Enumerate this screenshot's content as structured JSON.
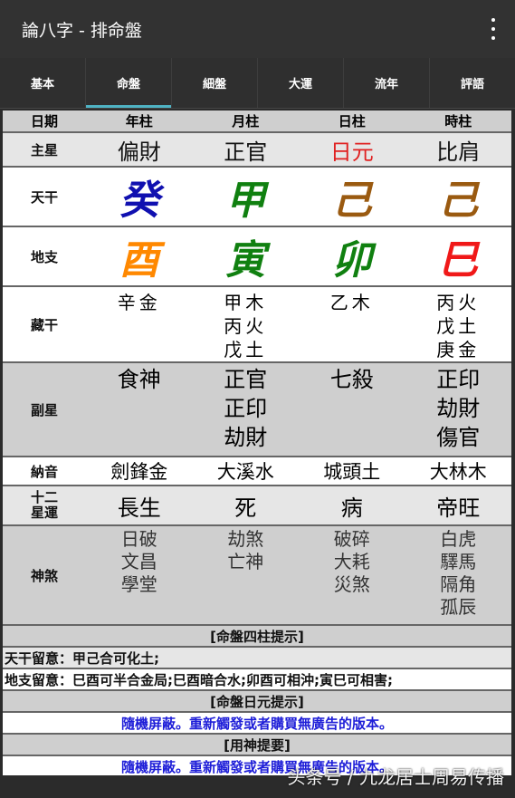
{
  "app": {
    "title": "論八字 - 排命盤"
  },
  "tabs": [
    {
      "label": "基本",
      "active": false
    },
    {
      "label": "命盤",
      "active": true
    },
    {
      "label": "細盤",
      "active": false
    },
    {
      "label": "大運",
      "active": false
    },
    {
      "label": "流年",
      "active": false
    },
    {
      "label": "評語",
      "active": false
    }
  ],
  "table": {
    "header": [
      "日期",
      "年柱",
      "月柱",
      "日柱",
      "時柱"
    ],
    "zhuxing": {
      "label": "主星",
      "values": [
        "偏財",
        "正官",
        "日元",
        "比肩"
      ],
      "colors": [
        "#111111",
        "#111111",
        "#e02020",
        "#111111"
      ]
    },
    "tiangan": {
      "label": "天干",
      "values": [
        "癸",
        "甲",
        "己",
        "己"
      ],
      "colors": [
        "#1010b0",
        "#108010",
        "#9a5a10",
        "#9a5a10"
      ]
    },
    "dizhi": {
      "label": "地支",
      "values": [
        "酉",
        "寅",
        "卯",
        "巳"
      ],
      "colors": [
        "#ff8800",
        "#108010",
        "#108010",
        "#f01818"
      ]
    },
    "canggan": {
      "label": "藏干",
      "values": [
        [
          "辛金"
        ],
        [
          "甲木",
          "丙火",
          "戊土"
        ],
        [
          "乙木"
        ],
        [
          "丙火",
          "戊土",
          "庚金"
        ]
      ]
    },
    "fuxing": {
      "label": "副星",
      "values": [
        [
          "食神"
        ],
        [
          "正官",
          "正印",
          "劫財"
        ],
        [
          "七殺"
        ],
        [
          "正印",
          "劫財",
          "傷官"
        ]
      ]
    },
    "nayin": {
      "label": "納音",
      "values": [
        "劍鋒金",
        "大溪水",
        "城頭土",
        "大林木"
      ]
    },
    "xingyun": {
      "label_top": "十二",
      "label_bottom": "星運",
      "values": [
        "長生",
        "死",
        "病",
        "帝旺"
      ]
    },
    "shensha": {
      "label": "神煞",
      "values": [
        [
          "日破",
          "文昌",
          "學堂"
        ],
        [
          "劫煞",
          "亡神"
        ],
        [
          "破碎",
          "大耗",
          "災煞"
        ],
        [
          "白虎",
          "驛馬",
          "隔角",
          "孤辰"
        ]
      ]
    }
  },
  "sections": {
    "sizhu_title": "[命盤四柱提示]",
    "tiangan_note": "天干留意：甲己合可化土;",
    "dizhi_note": "地支留意：巳酉可半合金局;巳酉暗合水;卯酉可相沖;寅巳可相害;",
    "riyuan_title": "[命盤日元提示]",
    "ad_text_1": "隨機屏蔽。重新觸發或者購買無廣告的版本。",
    "yongshen_title": "[用神提要]",
    "ad_text_2": "隨機屏蔽。重新觸發或者購買無廣告的版本。"
  },
  "watermark": "头条号 / 九龙居士周易传播"
}
